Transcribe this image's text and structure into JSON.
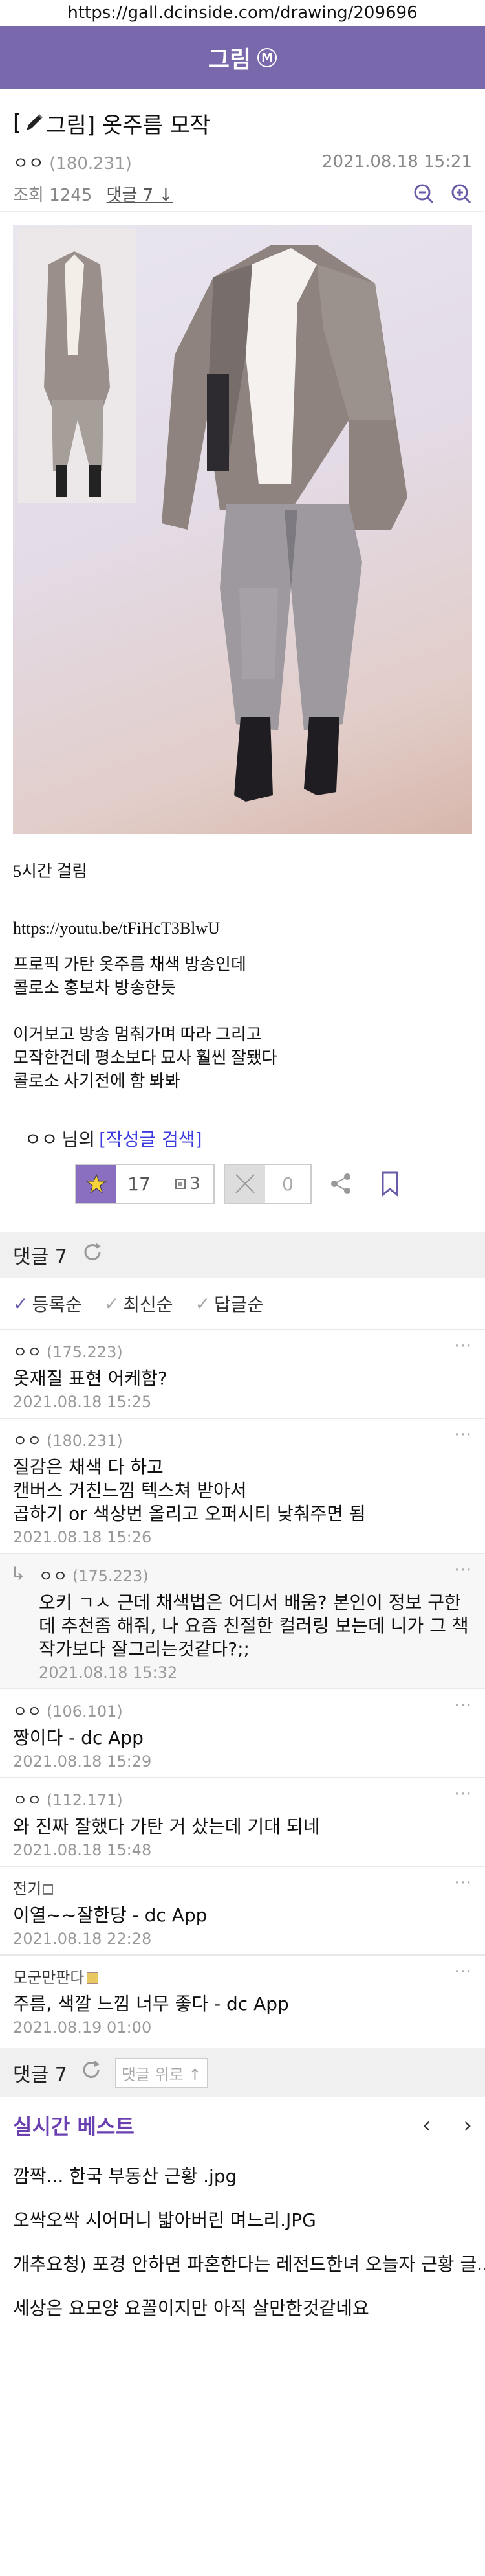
{
  "url": "https://gall.dcinside.com/drawing/209696",
  "gallery": {
    "title": "그림",
    "badge": "M"
  },
  "post": {
    "head": "[",
    "title": "그림] 옷주름 모작",
    "nick": "ㅇㅇ",
    "ip": "(180.231)",
    "date": "2021.08.18 15:21",
    "views_label": "조회 1245",
    "comments_link": "댓글 7",
    "body": [
      "5시간 걸림",
      "",
      "",
      "",
      "https://youtu.be/tFiHcT3BlwU",
      "",
      "프로픽 가탄 옷주름 채색 방송인데",
      "콜로소 홍보차 방송한듯",
      "",
      "이거보고 방송 멈춰가며 따라 그리고",
      "모작한건데 평소보다 묘사 훨씬 잘됐다",
      "콜로소 사기전에 함 봐봐"
    ]
  },
  "author": {
    "nick": "ㅇㅇ",
    "suffix": "님의",
    "search": "[작성글 검색]"
  },
  "reactions": {
    "recommend": "17",
    "fixed_recommend": "3",
    "not_recommend": "0"
  },
  "comments_header": "댓글 7",
  "sort": [
    "등록순",
    "최신순",
    "답글순"
  ],
  "comments": [
    {
      "nick": "ㅇㅇ",
      "ip": "(175.223)",
      "text": "옷재질 표현 어케함?",
      "date": "2021.08.18 15:25"
    },
    {
      "nick": "ㅇㅇ",
      "ip": "(180.231)",
      "text": "질감은 채색 다 하고\n캔버스 거친느낌 텍스쳐 받아서\n곱하기 or 색상번 올리고 오퍼시티 낮춰주면 됨",
      "date": "2021.08.18 15:26"
    },
    {
      "nick": "ㅇㅇ",
      "ip": "(175.223)",
      "text": "오키 ㄱㅅ 근데 채색법은 어디서 배움? 본인이 정보 구한데 추천좀 해줘, 나 요즘 친절한 컬러링 보는데 니가 그 책 작가보다 잘그리는것같다?;;",
      "date": "2021.08.18 15:32",
      "reply": true
    },
    {
      "nick": "ㅇㅇ",
      "ip": "(106.101)",
      "text": "짱이다 - dc App",
      "date": "2021.08.18 15:29"
    },
    {
      "nick": "ㅇㅇ",
      "ip": "(112.171)",
      "text": "와 진짜 잘했다 가탄 거 샀는데 기대 되네",
      "date": "2021.08.18 15:48"
    },
    {
      "nick": "전기",
      "ip": "",
      "text": "이열~~잘한당 - dc App",
      "date": "2021.08.18 22:28",
      "fixed": true
    },
    {
      "nick": "모군만판다",
      "ip": "",
      "text": "주름, 색깔 느낌 너무 좋다 - dc App",
      "date": "2021.08.19 01:00",
      "gonick": true
    }
  ],
  "footer": {
    "count": "댓글 7",
    "up": "댓글 위로 ↑"
  },
  "best": {
    "title": "실시간 베스트",
    "items": [
      "깜짝... 한국 부동산 근황 .jpg",
      "오싹오싹 시어머니 밟아버린 며느리.JPG",
      "개추요청) 포경 안하면 파혼한다는 레전드한녀 오늘자 근황 글...",
      "세상은 요모양 요꼴이지만 아직 살만한것같네요"
    ]
  },
  "colors": {
    "brand": "#7a68ad",
    "accent": "#6a3fb0"
  }
}
